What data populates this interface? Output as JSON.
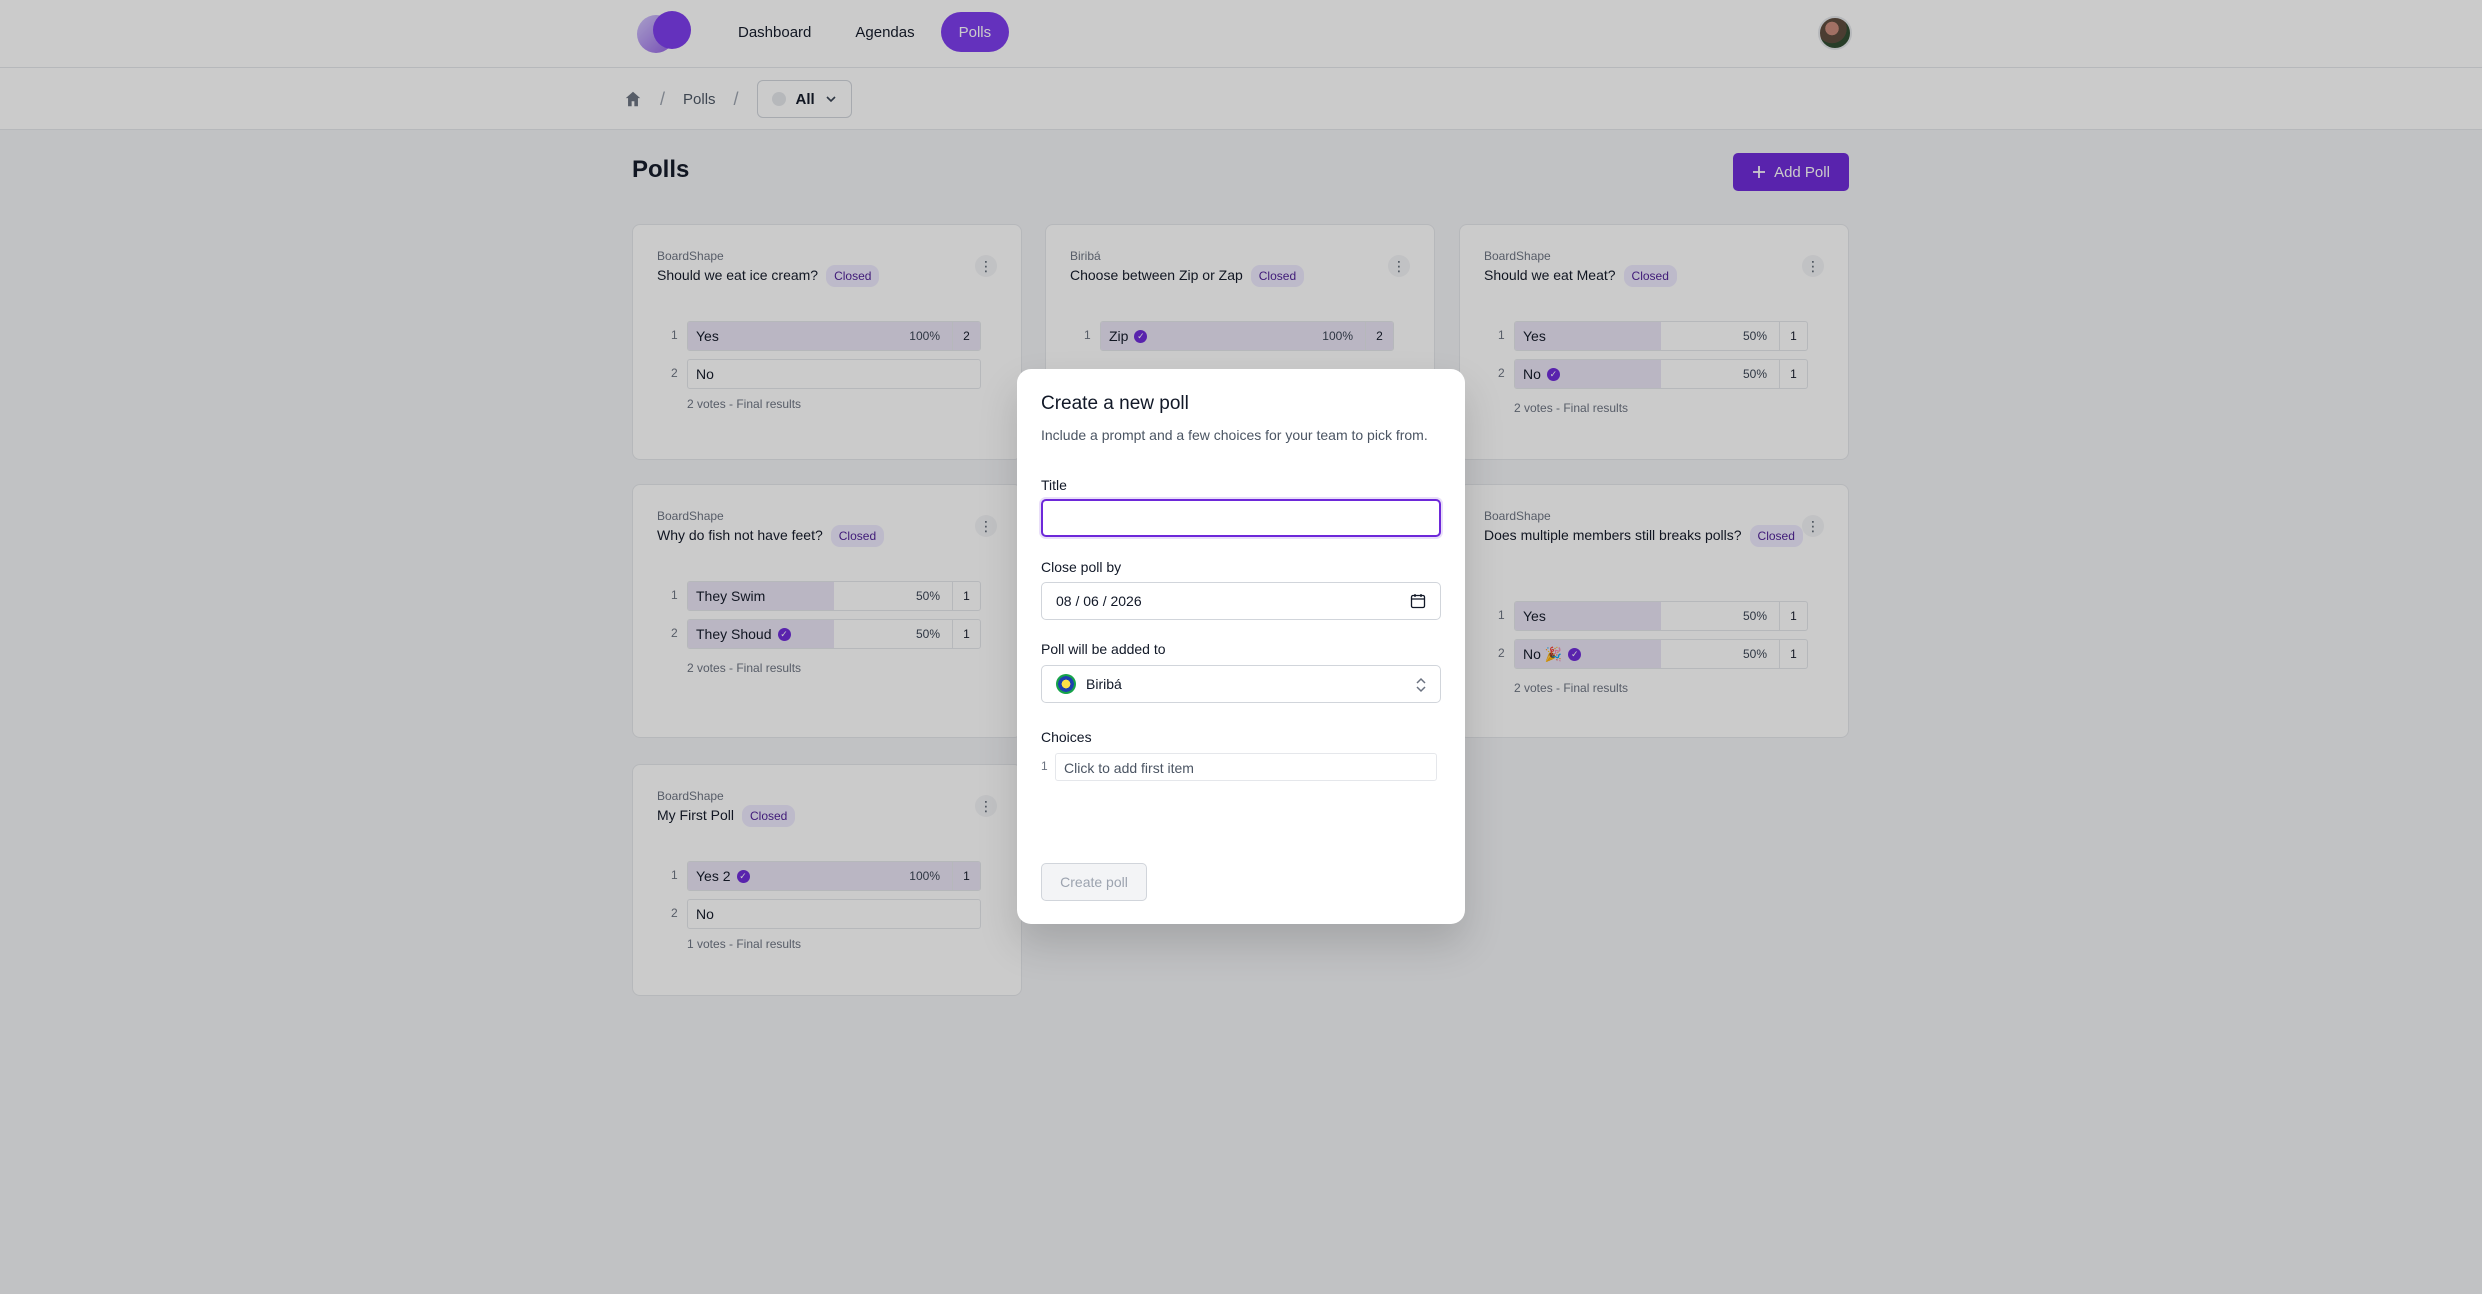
{
  "nav": {
    "items": [
      {
        "label": "Dashboard"
      },
      {
        "label": "Agendas"
      },
      {
        "label": "Polls"
      }
    ]
  },
  "breadcrumb": {
    "section": "Polls",
    "filter": "All"
  },
  "page": {
    "title": "Polls",
    "add_button": "Add Poll"
  },
  "polls": [
    {
      "org": "BoardShape",
      "title": "Should we eat ice cream?",
      "status": "Closed",
      "choices": [
        {
          "num": "1",
          "label": "Yes",
          "pct": "100%",
          "count": "2",
          "fill": 1.0,
          "winner": false
        },
        {
          "num": "2",
          "label": "No",
          "pct": "",
          "count": "",
          "fill": 0,
          "winner": false
        }
      ],
      "footer": "2 votes - Final results"
    },
    {
      "org": "Biribá",
      "title": "Choose between Zip or Zap",
      "status": "Closed",
      "choices": [
        {
          "num": "1",
          "label": "Zip",
          "pct": "100%",
          "count": "2",
          "fill": 1.0,
          "winner": true
        }
      ],
      "footer": ""
    },
    {
      "org": "BoardShape",
      "title": "Should we eat Meat?",
      "status": "Closed",
      "choices": [
        {
          "num": "1",
          "label": "Yes",
          "pct": "50%",
          "count": "1",
          "fill": 0.5,
          "winner": false
        },
        {
          "num": "2",
          "label": "No",
          "pct": "50%",
          "count": "1",
          "fill": 0.5,
          "winner": true
        }
      ],
      "footer": "2 votes - Final results"
    },
    {
      "org": "BoardShape",
      "title": "Why do fish not have feet?",
      "status": "Closed",
      "choices": [
        {
          "num": "1",
          "label": "They Swim",
          "pct": "50%",
          "count": "1",
          "fill": 0.5,
          "winner": false
        },
        {
          "num": "2",
          "label": "They Shoud",
          "pct": "50%",
          "count": "1",
          "fill": 0.5,
          "winner": true
        }
      ],
      "footer": "2 votes - Final results"
    },
    {
      "org": "BoardShape",
      "title": "Does multiple members still breaks polls?",
      "status": "Closed",
      "choices": [
        {
          "num": "1",
          "label": "Yes",
          "pct": "50%",
          "count": "1",
          "fill": 0.5,
          "winner": false
        },
        {
          "num": "2",
          "label": "No 🎉",
          "pct": "50%",
          "count": "1",
          "fill": 0.5,
          "winner": true
        }
      ],
      "footer": "2 votes - Final results"
    },
    {
      "org": "BoardShape",
      "title": "My First Poll",
      "status": "Closed",
      "choices": [
        {
          "num": "1",
          "label": "Yes 2",
          "pct": "100%",
          "count": "1",
          "fill": 1.0,
          "winner": true
        },
        {
          "num": "2",
          "label": "No",
          "pct": "",
          "count": "",
          "fill": 0,
          "winner": false
        }
      ],
      "footer": "1 votes - Final results"
    }
  ],
  "modal": {
    "title": "Create a new poll",
    "description": "Include a prompt and a few choices for your team to pick from.",
    "title_label": "Title",
    "title_value": "",
    "close_label": "Close poll by",
    "close_value": "08 / 06 / 2026",
    "org_label": "Poll will be added to",
    "org_value": "Biribá",
    "choices_label": "Choices",
    "choice_num": "1",
    "choice_placeholder": "Click to add first item",
    "create_button": "Create poll"
  },
  "colors": {
    "accent": "#6d28d9",
    "badge_bg": "#ede9fe",
    "fill": "#e9e4f5"
  }
}
